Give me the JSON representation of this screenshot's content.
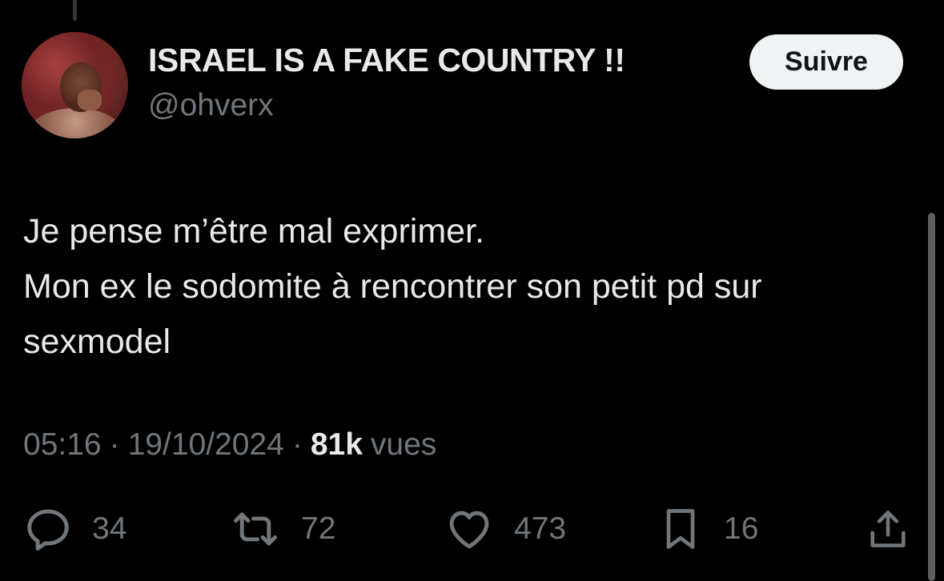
{
  "user": {
    "display_name": "ISRAEL IS A FAKE COUNTRY !!",
    "handle": "@ohverx",
    "avatar_icon": "profile-photo"
  },
  "follow_button": {
    "label": "Suivre"
  },
  "tweet": {
    "lines": [
      "Je pense m’être mal exprimer.",
      "Mon ex le sodomite à rencontrer son petit pd sur",
      "sexmodel"
    ]
  },
  "meta": {
    "time": "05:16",
    "separator": "·",
    "date": "19/10/2024",
    "views_count": "81k",
    "views_label": "vues"
  },
  "actions": {
    "reply": {
      "icon": "reply-icon",
      "count": "34"
    },
    "retweet": {
      "icon": "retweet-icon",
      "count": "72"
    },
    "like": {
      "icon": "heart-icon",
      "count": "473"
    },
    "bookmark": {
      "icon": "bookmark-icon",
      "count": "16"
    },
    "share": {
      "icon": "share-icon"
    }
  },
  "colors": {
    "background": "#000000",
    "primary_text": "#e7e9ea",
    "secondary_text": "#71767b",
    "button_bg": "#eff3f4",
    "button_text": "#0f1419"
  }
}
